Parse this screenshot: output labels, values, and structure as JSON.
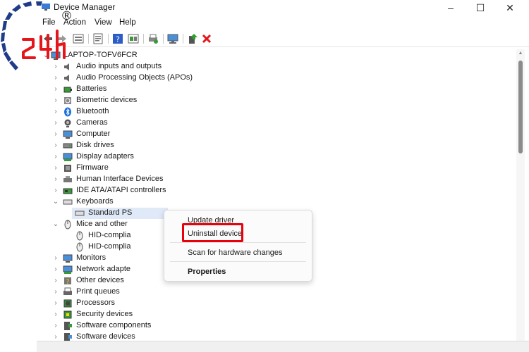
{
  "window": {
    "title": "Device Manager"
  },
  "menu": [
    "File",
    "Action",
    "View",
    "Help"
  ],
  "tree": {
    "computer": "LAPTOP-TOFV6FCR",
    "categories": [
      {
        "label": "Audio inputs and outputs",
        "icon": "speaker-icon"
      },
      {
        "label": "Audio Processing Objects (APOs)",
        "icon": "speaker-icon"
      },
      {
        "label": "Batteries",
        "icon": "battery-icon"
      },
      {
        "label": "Biometric devices",
        "icon": "fingerprint-icon"
      },
      {
        "label": "Bluetooth",
        "icon": "bluetooth-icon"
      },
      {
        "label": "Cameras",
        "icon": "camera-icon"
      },
      {
        "label": "Computer",
        "icon": "monitor-icon"
      },
      {
        "label": "Disk drives",
        "icon": "disk-icon"
      },
      {
        "label": "Display adapters",
        "icon": "display-adapter-icon"
      },
      {
        "label": "Firmware",
        "icon": "chip-icon"
      },
      {
        "label": "Human Interface Devices",
        "icon": "hid-icon"
      },
      {
        "label": "IDE ATA/ATAPI controllers",
        "icon": "controller-icon"
      },
      {
        "label": "Keyboards",
        "icon": "keyboard-icon"
      },
      {
        "label": "Standard PS",
        "icon": "keyboard-icon"
      },
      {
        "label": "Mice and other",
        "icon": "mouse-icon"
      },
      {
        "label": "HID-complia",
        "icon": "mouse-icon"
      },
      {
        "label": "HID-complia",
        "icon": "mouse-icon"
      },
      {
        "label": "Monitors",
        "icon": "monitor-icon"
      },
      {
        "label": "Network adapte",
        "icon": "network-icon"
      },
      {
        "label": "Other devices",
        "icon": "unknown-device-icon"
      },
      {
        "label": "Print queues",
        "icon": "printer-icon"
      },
      {
        "label": "Processors",
        "icon": "processor-icon"
      },
      {
        "label": "Security devices",
        "icon": "security-icon"
      },
      {
        "label": "Software components",
        "icon": "software-icon"
      },
      {
        "label": "Software devices",
        "icon": "software-icon"
      }
    ]
  },
  "context_menu": {
    "update_driver": "Update driver",
    "uninstall_device": "Uninstall device",
    "scan": "Scan for hardware changes",
    "properties": "Properties"
  },
  "logo": {
    "text": "24h",
    "trademark": "®"
  },
  "colors": {
    "highlight": "#e8000b",
    "logo_red": "#e4161b",
    "logo_blue": "#1f3c88",
    "selection": "#dfe9f7"
  }
}
